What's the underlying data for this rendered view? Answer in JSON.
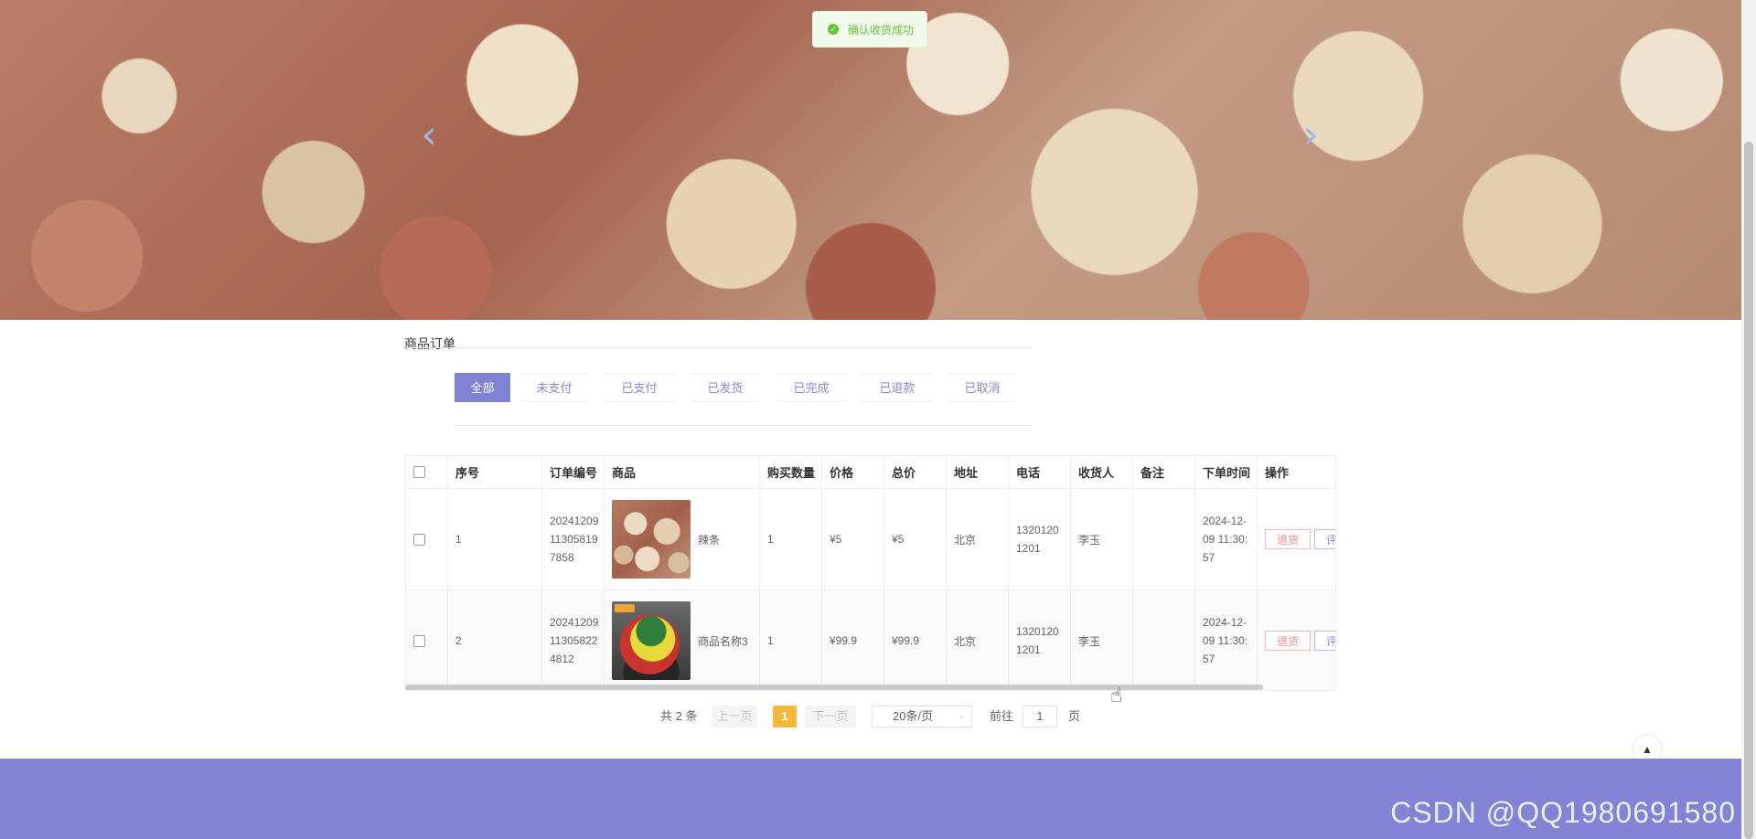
{
  "toast": {
    "text": "确认收货成功"
  },
  "banner": {
    "prev_icon": "‹",
    "next_icon": "›"
  },
  "section": {
    "title": "商品订单"
  },
  "tabs": [
    "全部",
    "未支付",
    "已支付",
    "已发货",
    "已完成",
    "已退款",
    "已取消"
  ],
  "active_tab": "全部",
  "table": {
    "headers": [
      "序号",
      "订单编号",
      "商品",
      "购买数量",
      "价格",
      "总价",
      "地址",
      "电话",
      "收货人",
      "备注",
      "下单时间",
      "操作"
    ],
    "rows": [
      {
        "index": "1",
        "order_no": "20241209113058197858",
        "product_name": "辣条",
        "quantity": "1",
        "price": "¥5",
        "total": "¥5",
        "address": "北京",
        "phone": "13201201201",
        "receiver": "李玉",
        "note": "",
        "time": "2024-12-09 11:30:57",
        "refund_label": "退货",
        "review_label": "评"
      },
      {
        "index": "2",
        "order_no": "20241209113058224812",
        "product_name": "商品名称3",
        "quantity": "1",
        "price": "¥99.9",
        "total": "¥99.9",
        "address": "北京",
        "phone": "13201201201",
        "receiver": "李玉",
        "note": "",
        "time": "2024-12-09 11:30:57",
        "refund_label": "退货",
        "review_label": "评"
      }
    ]
  },
  "pagination": {
    "total_text": "共 2 条",
    "prev_label": "上一页",
    "current_page": "1",
    "next_label": "下一页",
    "page_size": "20条/页",
    "goto_label": "前往",
    "goto_value": "1",
    "page_unit": "页"
  },
  "footer": {
    "watermark": "CSDN @QQ1980691580"
  },
  "colors": {
    "accent": "#7f82d2",
    "footer": "#8283d4",
    "success": "#67c23a",
    "page_active": "#f2b83a"
  }
}
